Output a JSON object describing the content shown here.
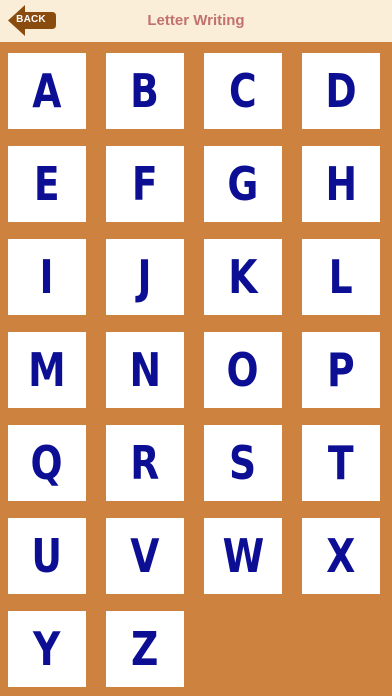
{
  "header": {
    "back_label": "BACK",
    "title": "Letter Writing",
    "back_icon": "back-arrow-icon"
  },
  "colors": {
    "background": "#cd833f",
    "header_bg": "#fbeed8",
    "title": "#c2726e",
    "back_button": "#8a4b0f",
    "letter": "#0c0e94",
    "tile": "#ffffff"
  },
  "letters": [
    "A",
    "B",
    "C",
    "D",
    "E",
    "F",
    "G",
    "H",
    "I",
    "J",
    "K",
    "L",
    "M",
    "N",
    "O",
    "P",
    "Q",
    "R",
    "S",
    "T",
    "U",
    "V",
    "W",
    "X",
    "Y",
    "Z"
  ]
}
